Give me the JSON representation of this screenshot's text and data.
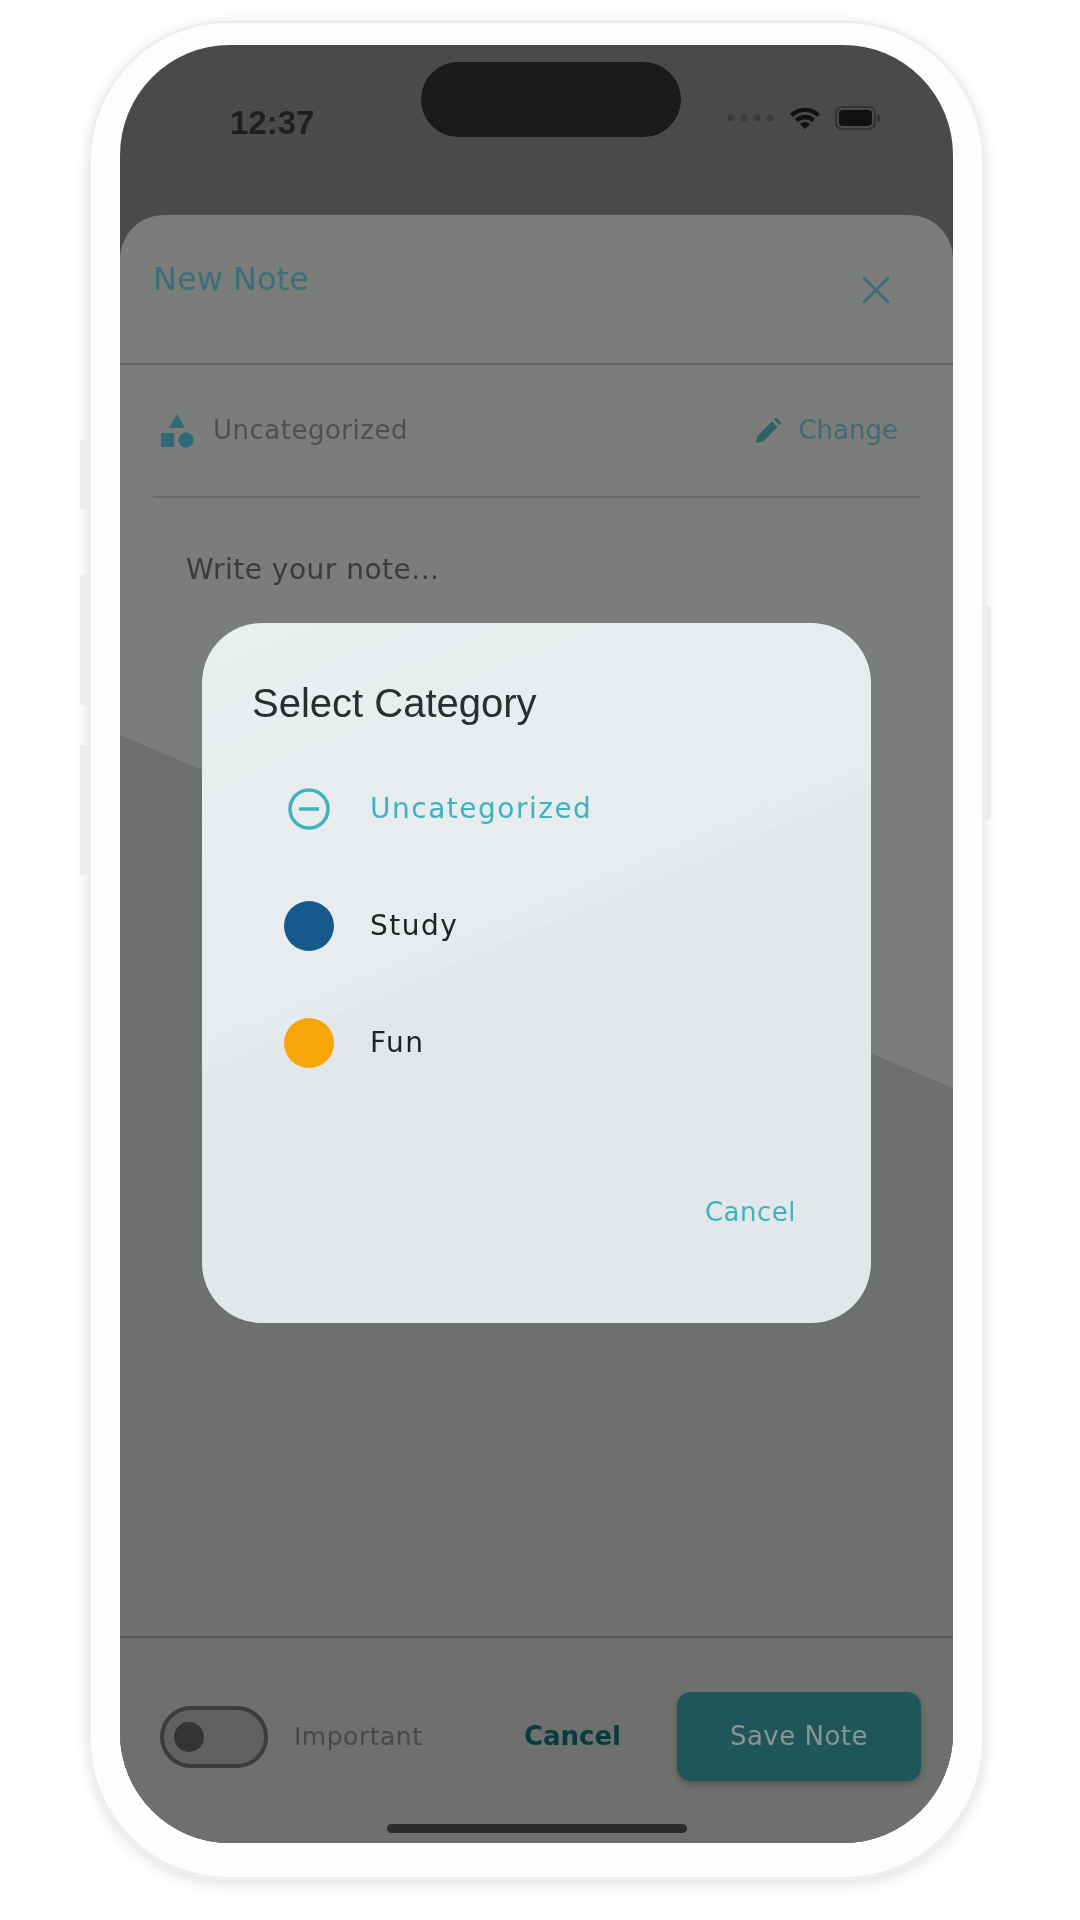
{
  "status_bar": {
    "time": "12:37"
  },
  "sheet": {
    "title": "New Note",
    "category": "Uncategorized",
    "change_label": "Change",
    "note": {
      "placeholder": "Write your note..."
    }
  },
  "dialog": {
    "title": "Select Category",
    "options": [
      {
        "label": "Uncategorized",
        "kind": "none",
        "selected": true
      },
      {
        "label": "Study",
        "kind": "color",
        "color": "#155a8a",
        "selected": false
      },
      {
        "label": "Fun",
        "kind": "color",
        "color": "#f6a609",
        "selected": false
      }
    ],
    "cancel_label": "Cancel"
  },
  "footer": {
    "important": {
      "label": "Important",
      "on": false
    },
    "cancel_label": "Cancel",
    "save_label": "Save Note"
  }
}
